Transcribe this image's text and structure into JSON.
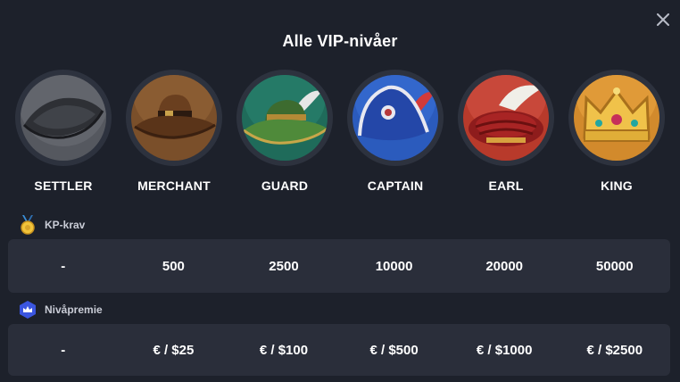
{
  "modal": {
    "title": "Alle VIP-nivåer",
    "close_icon": "close-icon"
  },
  "levels": [
    {
      "name": "SETTLER",
      "icon": "settler-hat-icon",
      "color": "#4a4d55"
    },
    {
      "name": "MERCHANT",
      "icon": "merchant-hat-icon",
      "color": "#7a4f2a"
    },
    {
      "name": "GUARD",
      "icon": "guard-hat-icon",
      "color": "#1f6b5a"
    },
    {
      "name": "CAPTAIN",
      "icon": "captain-hat-icon",
      "color": "#2b5bbd"
    },
    {
      "name": "EARL",
      "icon": "earl-hat-icon",
      "color": "#b83a2b"
    },
    {
      "name": "KING",
      "icon": "king-crown-icon",
      "color": "#d28a2c"
    }
  ],
  "kp_requirement": {
    "label": "KP-krav",
    "icon": "medal-icon",
    "values": [
      "-",
      "500",
      "2500",
      "10000",
      "20000",
      "50000"
    ]
  },
  "level_bonus": {
    "label": "Nivåpremie",
    "icon": "crown-badge-icon",
    "values": [
      "-",
      "€ / $25",
      "€ / $100",
      "€ / $500",
      "€ / $1000",
      "€ / $2500"
    ]
  },
  "colors": {
    "background": "#1d212b",
    "row": "#2a2e3a",
    "text": "#ffffff",
    "muted": "#c9ccd6"
  }
}
